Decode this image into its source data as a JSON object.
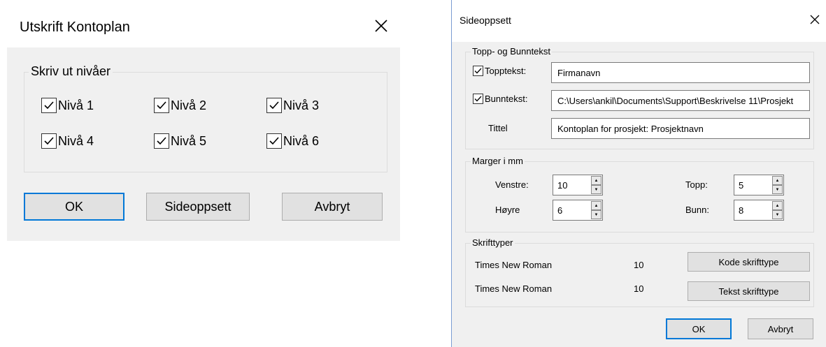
{
  "print_dialog": {
    "title": "Utskrift Kontoplan",
    "levels_group_label": "Skriv ut nivåer",
    "levels": [
      {
        "label": "Nivå 1",
        "checked": true
      },
      {
        "label": "Nivå 2",
        "checked": true
      },
      {
        "label": "Nivå 3",
        "checked": true
      },
      {
        "label": "Nivå 4",
        "checked": true
      },
      {
        "label": "Nivå 5",
        "checked": true
      },
      {
        "label": "Nivå 6",
        "checked": true
      }
    ],
    "buttons": {
      "ok": "OK",
      "page_setup": "Sideoppsett",
      "cancel": "Avbryt"
    }
  },
  "page_setup_dialog": {
    "title": "Sideoppsett",
    "header_footer": {
      "group_label": "Topp- og Bunntekst",
      "header_label": "Topptekst:",
      "header_checked": true,
      "header_value": "Firmanavn",
      "footer_label": "Bunntekst:",
      "footer_checked": true,
      "footer_value": "C:\\Users\\ankil\\Documents\\Support\\Beskrivelse 11\\Prosjekt",
      "title_label": "Tittel",
      "title_value": "Kontoplan for prosjekt: Prosjektnavn"
    },
    "margins": {
      "group_label": "Marger i mm",
      "left_label": "Venstre:",
      "left_value": "10",
      "right_label": "Høyre",
      "right_value": "6",
      "top_label": "Topp:",
      "top_value": "5",
      "bottom_label": "Bunn:",
      "bottom_value": "8"
    },
    "fonts": {
      "group_label": "Skrifttyper",
      "code_font_name": "Times New Roman",
      "code_font_size": "10",
      "text_font_name": "Times New Roman",
      "text_font_size": "10",
      "code_font_button": "Kode skrifttype",
      "text_font_button": "Tekst skrifttype"
    },
    "buttons": {
      "ok": "OK",
      "cancel": "Avbryt"
    }
  }
}
